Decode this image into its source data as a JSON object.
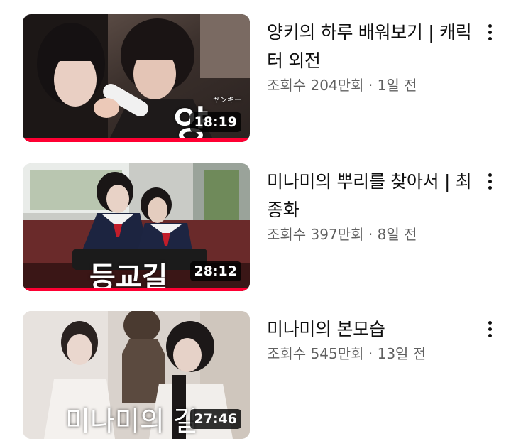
{
  "videos": [
    {
      "title": "양키의 하루 배워보기 | 캐릭터 외전",
      "stats": "조회수 204만회 · 1일 전",
      "duration": "18:19",
      "watched_fraction": 1.0,
      "thumb_overlay": "양",
      "thumb_overlay_small": "ヤンキー"
    },
    {
      "title": "미나미의 뿌리를 찾아서 | 최종화",
      "stats": "조회수 397만회 · 8일 전",
      "duration": "28:12",
      "watched_fraction": 1.0,
      "thumb_overlay": "등교길"
    },
    {
      "title": "미나미의 본모습",
      "stats": "조회수 545만회 · 13일 전",
      "duration": "27:46",
      "watched_fraction": 0.0,
      "thumb_overlay": "미나미의 길"
    }
  ],
  "colors": {
    "progress": "#ff0033",
    "title": "#0f0f0f",
    "stats": "#606060"
  },
  "icons": {
    "more": "more-vert-icon"
  }
}
